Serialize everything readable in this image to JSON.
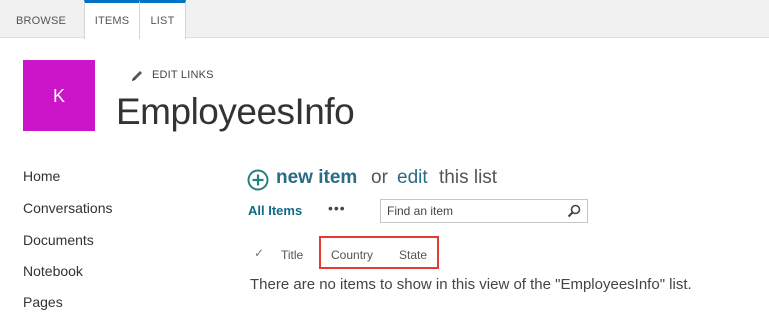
{
  "ribbon": {
    "tabs": [
      {
        "label": "BROWSE"
      },
      {
        "label": "ITEMS"
      },
      {
        "label": "LIST"
      }
    ]
  },
  "site": {
    "logo_letter": "K",
    "edit_links": "EDIT LINKS",
    "title": "EmployeesInfo"
  },
  "nav": {
    "items": [
      {
        "label": "Home"
      },
      {
        "label": "Conversations"
      },
      {
        "label": "Documents"
      },
      {
        "label": "Notebook"
      },
      {
        "label": "Pages"
      }
    ]
  },
  "list": {
    "new_item": "new item",
    "or": "or",
    "edit": "edit",
    "this_list": "this list",
    "view": "All Items",
    "more": "•••",
    "search_placeholder": "Find an item",
    "columns": [
      "Title",
      "Country",
      "State"
    ],
    "empty_message": "There are no items to show in this view of the \"EmployeesInfo\" list."
  },
  "colors": {
    "accent": "#0072c6",
    "logo_bg": "#cc14c8",
    "link": "#2a6b86",
    "highlight": "#e53935"
  }
}
